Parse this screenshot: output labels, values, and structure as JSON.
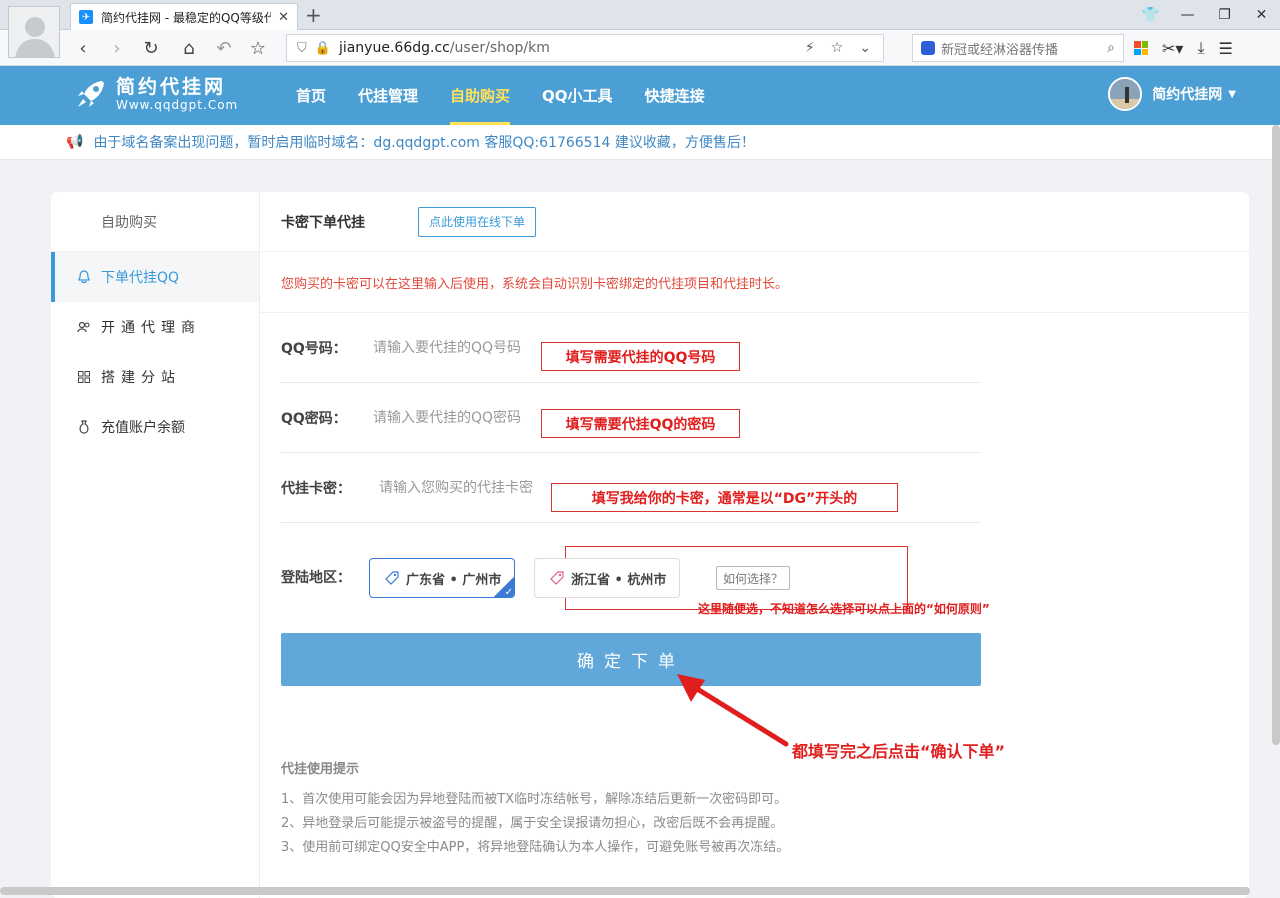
{
  "browser": {
    "tab_title": "简约代挂网 - 最稳定的QQ等级代挂网站",
    "url_domain": "jianyue.66dg.cc",
    "url_path": "/user/shop/km",
    "search_placeholder": "新冠或经淋浴器传播"
  },
  "site": {
    "logo_name": "简约代挂网",
    "logo_url": "Www.qqdgpt.Com",
    "nav": [
      "首页",
      "代挂管理",
      "自助购买",
      "QQ小工具",
      "快捷连接"
    ],
    "active_nav": "自助购买",
    "user_name": "简约代挂网",
    "notice": "由于域名备案出现问题，暂时启用临时域名：dg.qqdgpt.com 客服QQ:61766514 建议收藏，方便售后！"
  },
  "sidebar": {
    "title": "自助购买",
    "items": [
      {
        "label": "下单代挂QQ",
        "active": true
      },
      {
        "label": "开通代理商"
      },
      {
        "label": "搭建分站"
      },
      {
        "label": "充值账户余额"
      }
    ]
  },
  "main": {
    "header_title": "卡密下单代挂",
    "online_button": "点此使用在线下单",
    "hint": "您购买的卡密可以在这里输入后使用，系统会自动识别卡密绑定的代挂项目和代挂时长。",
    "qq_label": "QQ号码：",
    "qq_placeholder": "请输入要代挂的QQ号码",
    "pwd_label": "QQ密码：",
    "pwd_placeholder": "请输入要代挂的QQ密码",
    "card_label": "代挂卡密：",
    "card_placeholder": "请输入您购买的代挂卡密",
    "region_label": "登陆地区：",
    "regions": [
      "广东省 • 广州市",
      "浙江省 • 杭州市"
    ],
    "how_button": "如何选择？",
    "submit": "确定下单",
    "tips_title": "代挂使用提示",
    "tips": [
      "1、首次使用可能会因为异地登陆而被TX临时冻结帐号，解除冻结后更新一次密码即可。",
      "2、异地登录后可能提示被盗号的提醒，属于安全误报请勿担心，改密后既不会再提醒。",
      "3、使用前可绑定QQ安全中APP，将异地登陆确认为本人操作，可避免账号被再次冻结。"
    ]
  },
  "annotations": {
    "qq": "填写需要代挂的QQ号码",
    "pwd": "填写需要代挂QQ的密码",
    "card": "填写我给你的卡密，通常是以“DG”开头的",
    "region": "这里随便选，不知道怎么选择可以点上面的“如何原则”",
    "submit": "都填写完之后点击“确认下单”"
  },
  "colors": {
    "header_bg": "#4b9fd5",
    "active_nav": "#ffe15a",
    "annotation_red": "#e11e1e",
    "submit_bg": "#5fa8d9"
  }
}
